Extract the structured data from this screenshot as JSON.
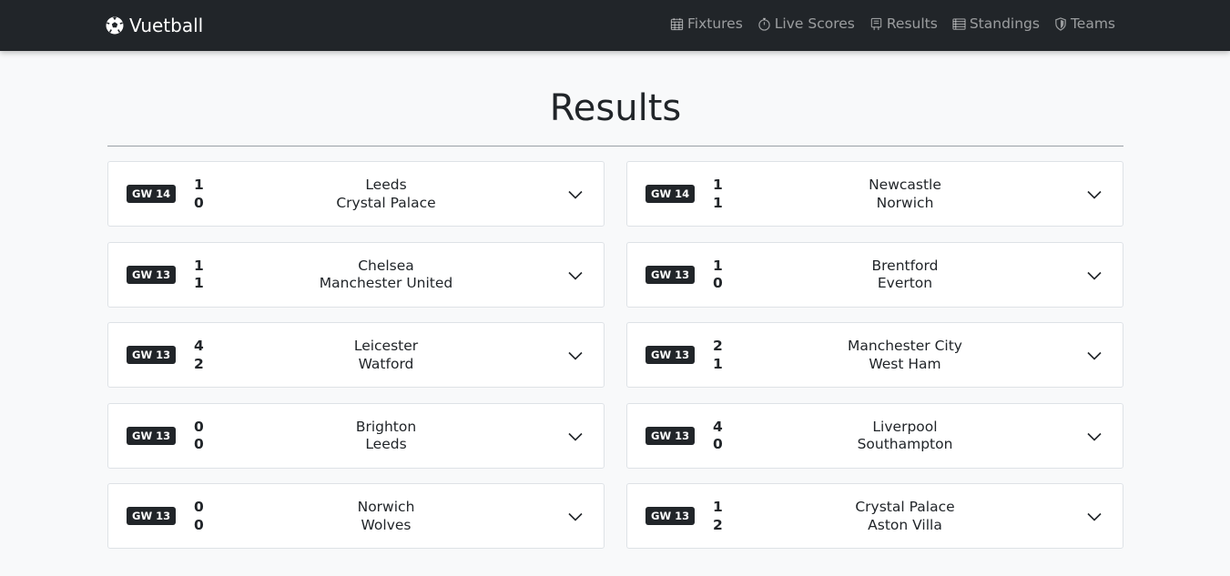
{
  "navbar": {
    "brand": "Vuetball",
    "brand_icon": "soccer-ball-icon",
    "links": [
      {
        "label": "Fixtures",
        "icon": "calendar-icon"
      },
      {
        "label": "Live Scores",
        "icon": "stopwatch-icon"
      },
      {
        "label": "Results",
        "icon": "clipboard-icon"
      },
      {
        "label": "Standings",
        "icon": "list-icon"
      },
      {
        "label": "Teams",
        "icon": "shield-icon"
      }
    ]
  },
  "page": {
    "title": "Results"
  },
  "results": [
    {
      "gameweek": "GW 14",
      "home_team": "Leeds",
      "away_team": "Crystal Palace",
      "home_score": "1",
      "away_score": "0"
    },
    {
      "gameweek": "GW 14",
      "home_team": "Newcastle",
      "away_team": "Norwich",
      "home_score": "1",
      "away_score": "1"
    },
    {
      "gameweek": "GW 13",
      "home_team": "Chelsea",
      "away_team": "Manchester United",
      "home_score": "1",
      "away_score": "1"
    },
    {
      "gameweek": "GW 13",
      "home_team": "Brentford",
      "away_team": "Everton",
      "home_score": "1",
      "away_score": "0"
    },
    {
      "gameweek": "GW 13",
      "home_team": "Leicester",
      "away_team": "Watford",
      "home_score": "4",
      "away_score": "2"
    },
    {
      "gameweek": "GW 13",
      "home_team": "Manchester City",
      "away_team": "West Ham",
      "home_score": "2",
      "away_score": "1"
    },
    {
      "gameweek": "GW 13",
      "home_team": "Brighton",
      "away_team": "Leeds",
      "home_score": "0",
      "away_score": "0"
    },
    {
      "gameweek": "GW 13",
      "home_team": "Liverpool",
      "away_team": "Southampton",
      "home_score": "4",
      "away_score": "0"
    },
    {
      "gameweek": "GW 13",
      "home_team": "Norwich",
      "away_team": "Wolves",
      "home_score": "0",
      "away_score": "0"
    },
    {
      "gameweek": "GW 13",
      "home_team": "Crystal Palace",
      "away_team": "Aston Villa",
      "home_score": "1",
      "away_score": "2"
    }
  ],
  "colors": {
    "navbar_bg": "#212529",
    "page_bg": "#f8f9fa",
    "badge_bg": "#212529",
    "card_border": "#dee2e6"
  }
}
